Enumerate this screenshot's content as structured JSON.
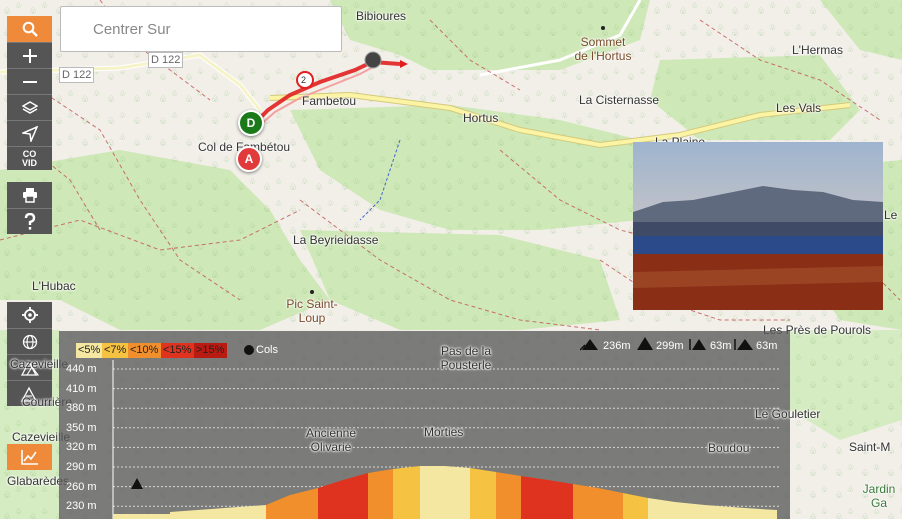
{
  "search": {
    "placeholder": "Centrer Sur"
  },
  "toolbar": {
    "covid_line1": "CO",
    "covid_line2": "VID"
  },
  "map_labels": {
    "bibioures": "Bibioures",
    "sommet_line1": "Sommet",
    "sommet_line2": "de l'Hortus",
    "lhermas": "L'Hermas",
    "d122a": "D 122",
    "d122b": "D 122",
    "fambetou": "Fambetou",
    "la_cisternasse": "La Cisternasse",
    "les_vals": "Les Vals",
    "hortus": "Hortus",
    "la_plaine": "La Plaine",
    "col_de_fambetou": "Col de Fambétou",
    "la_beyrieidasse": "La Beyrieidasse",
    "lhubac": "L'Hubac",
    "pic_line1": "Pic Saint-",
    "pic_line2": "Loup",
    "les_pres": "Les Près de Pourols",
    "cazevieille_top": "Cazevieille",
    "pas_line1": "Pas de la",
    "pas_line2": "Pousterle",
    "courriere": "Courrière",
    "le_gouletier": "Le Gouletier",
    "cazevieille": "Cazevieille",
    "ancienne_line1": "Ancienne",
    "ancienne_line2": "Olivarié",
    "morties": "Morties",
    "boudou": "Boudou",
    "saint_m": "Saint-M",
    "glabarèdes": "Glabarèdes",
    "jardin_line1": "Jardin",
    "jardin_line2": "Ga",
    "le_right": "Le",
    "route_number": "2"
  },
  "markers": {
    "depart": "D",
    "arrivee": "A"
  },
  "elevation": {
    "legend": [
      {
        "label": "<5%",
        "color": "#f3e7a2"
      },
      {
        "label": "<7%",
        "color": "#f5c242"
      },
      {
        "label": "<10%",
        "color": "#f08f2b"
      },
      {
        "label": "<15%",
        "color": "#e0331f"
      },
      {
        "label": ">15%",
        "color": "#b81b12"
      }
    ],
    "cols_label": "Cols",
    "peaks": {
      "p1": "236m",
      "p2": "299m",
      "p3": "63m",
      "p4": "63m"
    },
    "y_ticks": [
      "440 m",
      "410 m",
      "380 m",
      "350 m",
      "320 m",
      "290 m",
      "260 m",
      "230 m"
    ]
  },
  "colors": {
    "toolbar_bg": "#555555",
    "accent_orange": "#ef8a3a",
    "route_red": "#e02020",
    "marker_green": "#1a7a1a",
    "marker_red": "#e03a3a"
  }
}
